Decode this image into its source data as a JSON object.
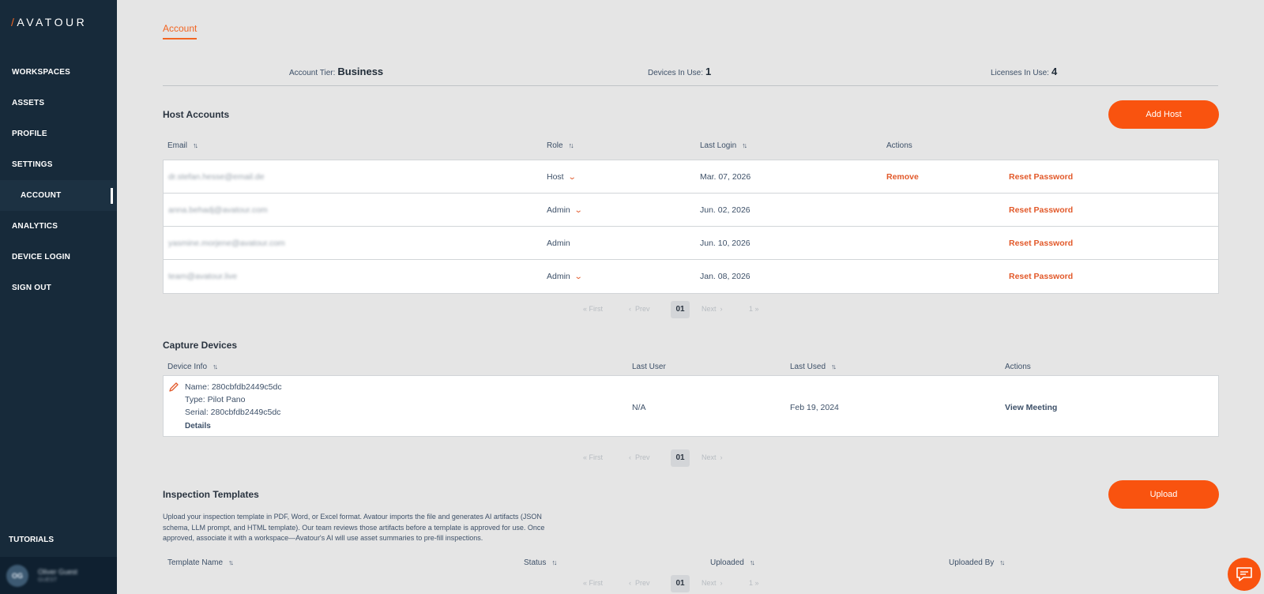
{
  "brand": {
    "logo_text": "AVATOUR"
  },
  "sidebar": {
    "items": [
      {
        "label": "WORKSPACES"
      },
      {
        "label": "ASSETS"
      },
      {
        "label": "PROFILE"
      },
      {
        "label": "SETTINGS"
      },
      {
        "label": "ACCOUNT"
      },
      {
        "label": "ANALYTICS"
      },
      {
        "label": "DEVICE LOGIN"
      },
      {
        "label": "SIGN OUT"
      }
    ],
    "tutorials": "TUTORIALS",
    "user": {
      "initials": "OG",
      "name": "Oliver Guest",
      "role": "GUEST"
    }
  },
  "tabs": {
    "account": "Account"
  },
  "stats": {
    "tier_label": "Account Tier:",
    "tier_value": "Business",
    "devices_label": "Devices In Use:",
    "devices_value": "1",
    "licenses_label": "Licenses In Use:",
    "licenses_value": "4"
  },
  "host_accounts": {
    "title": "Host Accounts",
    "add_button": "Add Host",
    "columns": {
      "email": "Email",
      "role": "Role",
      "last_login": "Last Login",
      "actions": "Actions"
    },
    "rows": [
      {
        "email": "dr.stefan.hesse@email.de",
        "role": "Host",
        "last_login": "Mar. 07, 2026",
        "remove": "Remove",
        "reset": "Reset Password"
      },
      {
        "email": "anna.behadj@avatour.com",
        "role": "Admin",
        "last_login": "Jun. 02, 2026",
        "reset": "Reset Password"
      },
      {
        "email": "yasmine.morjene@avatour.com",
        "role": "Admin",
        "last_login": "Jun. 10, 2026",
        "reset": "Reset Password"
      },
      {
        "email": "team@avatour.live",
        "role": "Admin",
        "last_login": "Jan. 08, 2026",
        "reset": "Reset Password"
      }
    ]
  },
  "pagination": {
    "first": "First",
    "prev": "Prev",
    "current": "01",
    "next": "Next",
    "last": "1"
  },
  "capture_devices": {
    "title": "Capture Devices",
    "columns": {
      "device_info": "Device Info",
      "last_user": "Last User",
      "last_used": "Last Used",
      "actions": "Actions"
    },
    "device": {
      "name": "Name: 280cbfdb2449c5dc",
      "type": "Type: Pilot Pano",
      "serial": "Serial: 280cbfdb2449c5dc",
      "details": "Details",
      "last_user": "N/A",
      "last_used": "Feb 19, 2024",
      "action": "View Meeting"
    }
  },
  "inspection_templates": {
    "title": "Inspection Templates",
    "upload_button": "Upload",
    "description": "Upload your inspection template in PDF, Word, or Excel format. Avatour imports the file and generates AI artifacts (JSON schema, LLM prompt, and HTML template). Our team reviews those artifacts before a template is approved for use. Once approved, associate it with a workspace—Avatour's AI will use asset summaries to pre-fill inspections.",
    "columns": {
      "template_name": "Template Name",
      "status": "Status",
      "uploaded": "Uploaded",
      "uploaded_by": "Uploaded By"
    }
  },
  "colors": {
    "accent": "#f9530f",
    "sidebar": "#172a3a",
    "background": "#e5e5e5"
  },
  "icons": {
    "sort": "sort-arrows-icon",
    "chevron": "chevron-down-icon",
    "edit": "pencil-icon",
    "chat": "chat-icon"
  }
}
